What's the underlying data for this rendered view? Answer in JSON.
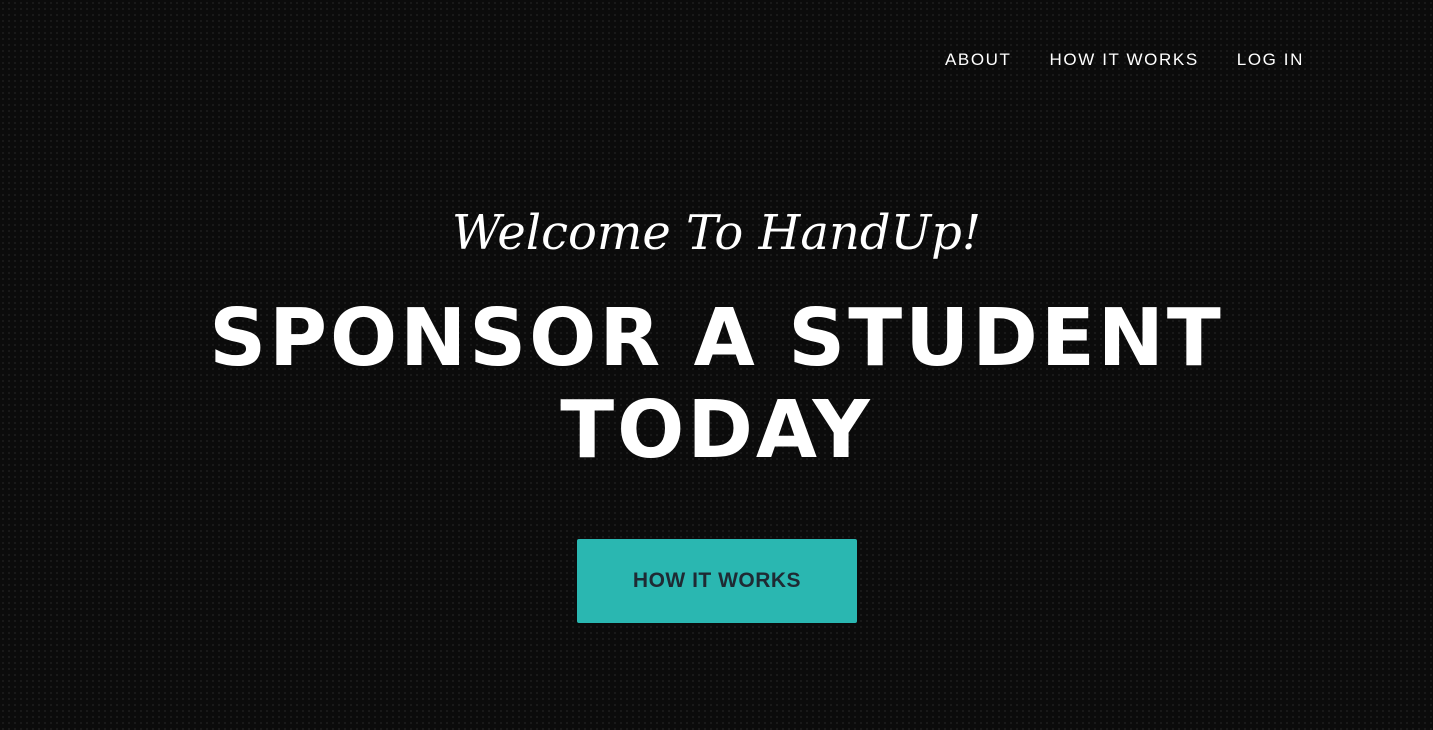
{
  "nav": {
    "items": [
      {
        "label": "ABOUT"
      },
      {
        "label": "HOW IT WORKS"
      },
      {
        "label": "LOG IN"
      }
    ]
  },
  "hero": {
    "welcome": "Welcome To HandUp!",
    "headline_line1": "SPONSOR A STUDENT",
    "headline_line2": "TODAY",
    "cta_label": "HOW IT WORKS"
  },
  "colors": {
    "background": "#0b0b0b",
    "text": "#ffffff",
    "accent": "#2ab7b1",
    "cta_text": "#1f2a33"
  }
}
